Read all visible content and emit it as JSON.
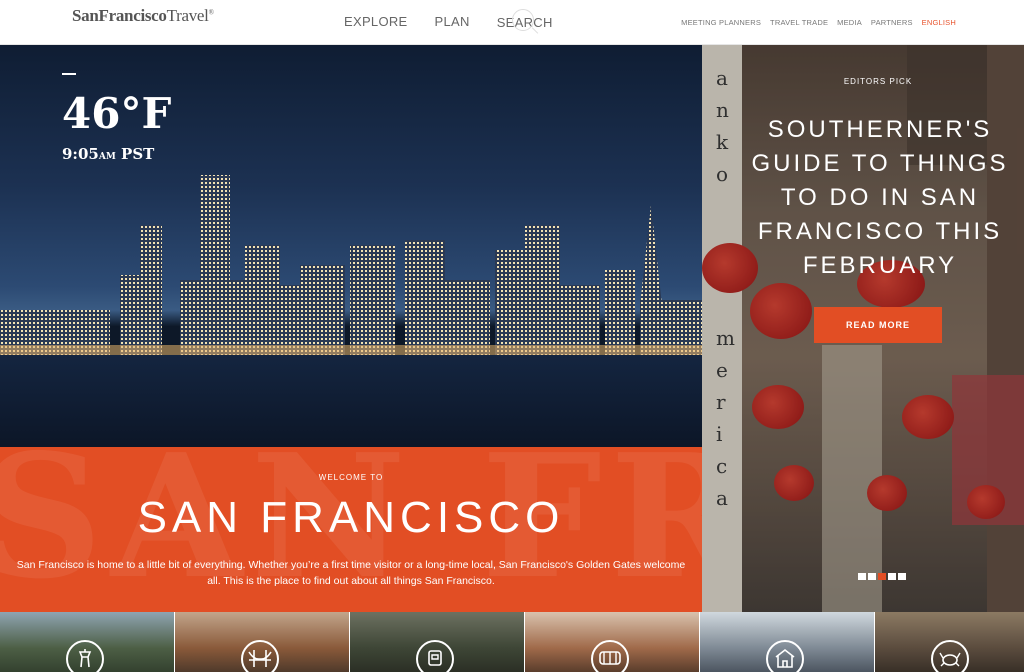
{
  "header": {
    "logo_bold": "SanFrancisco",
    "logo_light": "Travel",
    "logo_mark": "®",
    "main_nav": [
      "EXPLORE",
      "PLAN",
      "SEARCH"
    ],
    "util_nav": [
      "MEETING PLANNERS",
      "TRAVEL TRADE",
      "MEDIA",
      "PARTNERS"
    ],
    "language": "ENGLISH"
  },
  "hero": {
    "temperature": "46°F",
    "time": "9:05",
    "am_pm": "AM",
    "timezone": "PST"
  },
  "welcome": {
    "background_text": "SAN FR",
    "eyebrow": "WELCOME TO",
    "title": "SAN FRANCISCO",
    "body": "San Francisco is home to a little bit of everything. Whether you’re a first time visitor or a long-time local, San Francisco's Golden Gates welcome all. This is the place to find out about all things San Francisco."
  },
  "editors_pick": {
    "label": "EDITORS PICK",
    "title": "SOUTHERNER'S GUIDE TO THINGS TO DO IN SAN FRANCISCO THIS FEBRUARY",
    "button": "READ MORE",
    "slides": 5,
    "active_slide": 2
  },
  "thumbnails": [
    {
      "icon": "lighthouse-tower-icon",
      "color": "#4d5f45"
    },
    {
      "icon": "golden-gate-bridge-icon",
      "color": "#8a5a3a"
    },
    {
      "icon": "cable-car-icon",
      "color": "#3e4636"
    },
    {
      "icon": "trolley-icon",
      "color": "#a06a4a"
    },
    {
      "icon": "painted-ladies-house-icon",
      "color": "#7f8a95"
    },
    {
      "icon": "crab-icon",
      "color": "#5b4c3e"
    }
  ],
  "colors": {
    "accent": "#e24e24",
    "header_text": "#666666"
  }
}
